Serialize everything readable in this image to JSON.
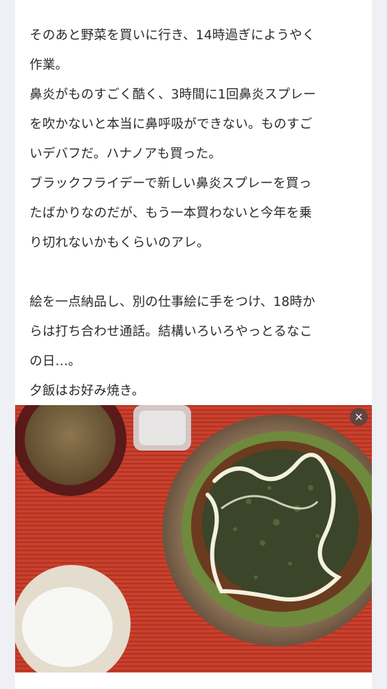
{
  "article": {
    "paragraphs": [
      [
        "そのあと野菜を買いに行き、14時過ぎにようやく",
        "作業。"
      ],
      [
        "鼻炎がものすごく酷く、3時間に1回鼻炎スプレー",
        "を吹かないと本当に鼻呼吸ができない。ものすご",
        "いデバフだ。ハナノアも買った。"
      ],
      [
        "ブラックフライデーで新しい鼻炎スプレーを買っ",
        "たばかりなのだが、もう一本買わないと今年を乗",
        "り切れないかもくらいのアレ。"
      ],
      [
        "絵を一点納品し、別の仕事絵に手をつけ、18時か",
        "らは打ち合わせ通話。結構いろいろやっとるなこ",
        "の日…。"
      ],
      [
        "夕飯はお好み焼き。"
      ]
    ]
  },
  "photo": {
    "close_icon": "×",
    "colors": {
      "placemat": "#c0392b",
      "plate": "#8a6f55",
      "okonomiyaki": "#4a5a2e",
      "mayo": "#f4f1df",
      "rice": "#f7f7f4",
      "soup": "#7a6440"
    }
  }
}
